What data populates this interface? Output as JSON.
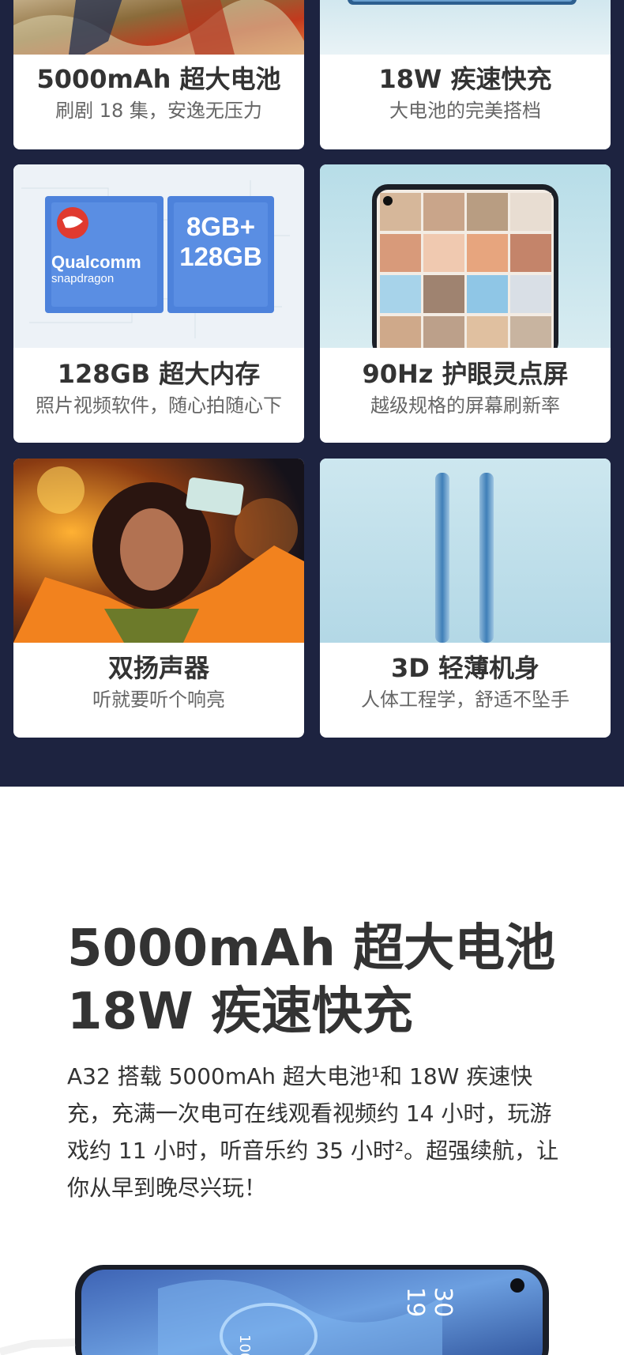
{
  "cards": [
    {
      "title": "5000mAh 超大电池",
      "subtitle": "刷剧 18 集，安逸无压力"
    },
    {
      "title": "18W 疾速快充",
      "subtitle": "大电池的完美搭档"
    },
    {
      "title": "128GB 超大内存",
      "subtitle": "照片视频软件，随心拍随心下"
    },
    {
      "title": "90Hz 护眼灵点屏",
      "subtitle": "越级规格的屏幕刷新率"
    },
    {
      "title": "双扬声器",
      "subtitle": "听就要听个响亮"
    },
    {
      "title": "3D 轻薄机身",
      "subtitle": "人体工程学，舒适不坠手"
    }
  ],
  "chip": {
    "brand": "Qualcomm",
    "sub": "snapdragon",
    "memory_line1": "8GB+",
    "memory_line2": "128GB"
  },
  "section": {
    "heading_line1": "5000mAh 超大电池",
    "heading_line2": "18W 疾速快充",
    "paragraph": "A32 搭载 5000mAh 超大电池¹和 18W 疾速快充，充满一次电可在线观看视频约 14 小时，玩游戏约 11 小时，听音乐约 35 小时²。超强续航，让你从早到晚尽兴玩！"
  },
  "phone_screen": {
    "time_h": "19",
    "time_m": "30",
    "battery": "100%"
  },
  "colors": {
    "dark_bg": "#1d2340",
    "card_bg": "#ffffff",
    "title": "#333333",
    "subtitle": "#666666"
  }
}
